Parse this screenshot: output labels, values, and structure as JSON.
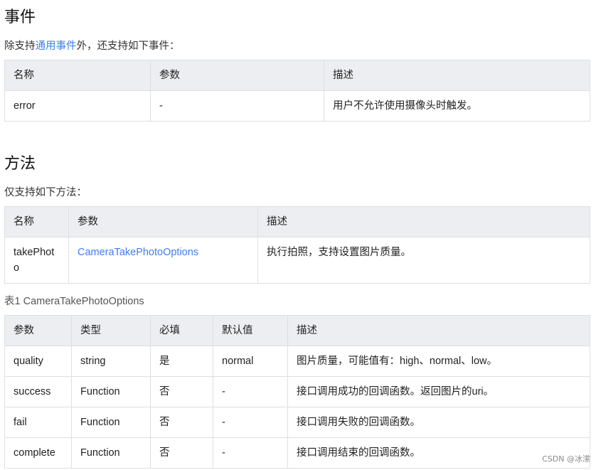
{
  "events_section": {
    "heading": "事件",
    "intro_prefix": "除支持",
    "intro_link": "通用事件",
    "intro_suffix": "外，还支持如下事件：",
    "columns": [
      "名称",
      "参数",
      "描述"
    ],
    "rows": [
      [
        "error",
        "-",
        "用户不允许使用摄像头时触发。"
      ]
    ]
  },
  "methods_section": {
    "heading": "方法",
    "intro": "仅支持如下方法：",
    "columns": [
      "名称",
      "参数",
      "描述"
    ],
    "rows": [
      {
        "name": "takePhoto",
        "param_link": "CameraTakePhotoOptions",
        "desc": "执行拍照，支持设置图片质量。"
      }
    ]
  },
  "options_table": {
    "caption": "表1 CameraTakePhotoOptions",
    "columns": [
      "参数",
      "类型",
      "必填",
      "默认值",
      "描述"
    ],
    "rows": [
      [
        "quality",
        "string",
        "是",
        "normal",
        "图片质量，可能值有：high、normal、low。"
      ],
      [
        "success",
        "Function",
        "否",
        "-",
        "接口调用成功的回调函数。返回图片的uri。"
      ],
      [
        "fail",
        "Function",
        "否",
        "-",
        "接口调用失败的回调函数。"
      ],
      [
        "complete",
        "Function",
        "否",
        "-",
        "接口调用结束的回调函数。"
      ]
    ]
  },
  "watermark": "CSDN @冰潆",
  "colors": {
    "link": "#3f7ee8",
    "header_bg": "#eceef1",
    "border": "#dcdfe4"
  }
}
